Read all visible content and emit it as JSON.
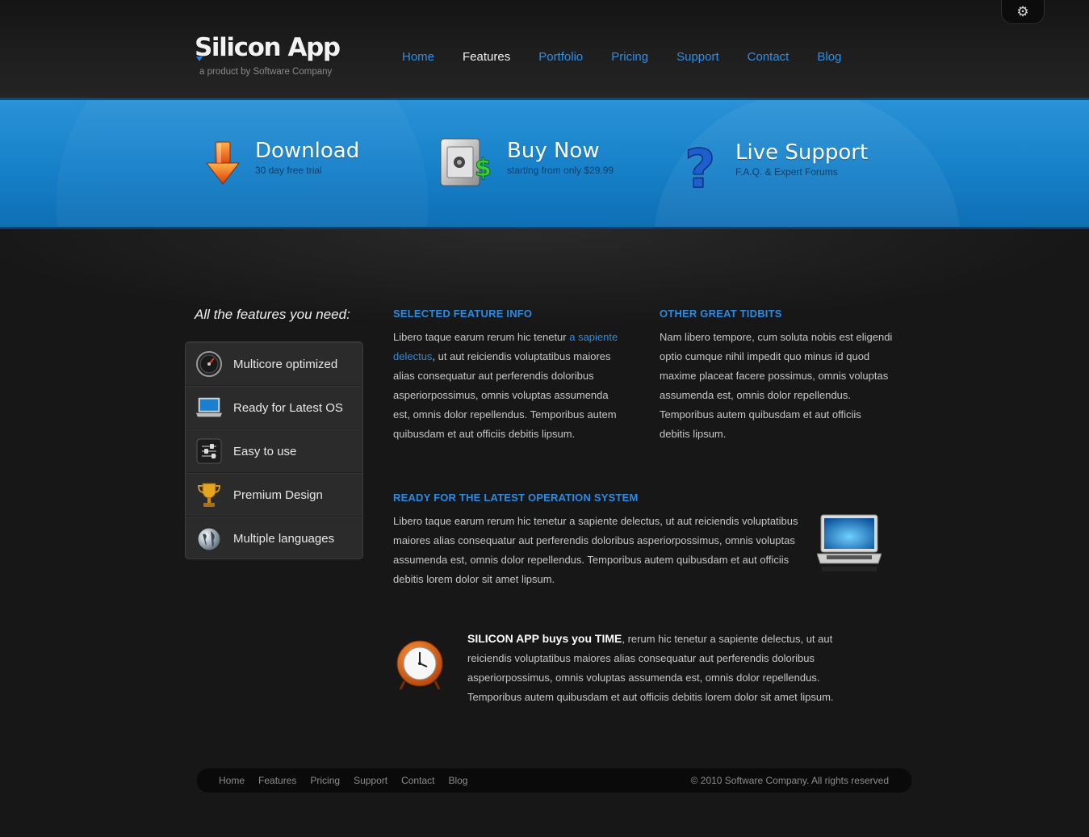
{
  "header": {
    "logo_title": "Silicon App",
    "logo_subtitle": "a product by Software Company",
    "settings_icon": "gears-icon",
    "nav": [
      {
        "label": "Home",
        "active": false
      },
      {
        "label": "Features",
        "active": true
      },
      {
        "label": "Portfolio",
        "active": false
      },
      {
        "label": "Pricing",
        "active": false
      },
      {
        "label": "Support",
        "active": false
      },
      {
        "label": "Contact",
        "active": false
      },
      {
        "label": "Blog",
        "active": false
      }
    ]
  },
  "banner": {
    "download": {
      "title": "Download",
      "subtitle": "30 day free trial",
      "icon": "download-arrow-icon"
    },
    "buy": {
      "title": "Buy Now",
      "subtitle": "starting from only $29.99",
      "icon": "safe-dollar-icon"
    },
    "support": {
      "title": "Live Support",
      "subtitle": "F.A.Q. & Expert Forums",
      "icon": "question-mark-icon"
    }
  },
  "features": {
    "heading": "All the features you need:",
    "items": [
      {
        "label": "Multicore optimized",
        "icon": "speedometer-icon"
      },
      {
        "label": "Ready for Latest OS",
        "icon": "laptop-icon"
      },
      {
        "label": "Easy to use",
        "icon": "sliders-icon"
      },
      {
        "label": "Premium Design",
        "icon": "trophy-icon"
      },
      {
        "label": "Multiple languages",
        "icon": "globe-icon"
      }
    ]
  },
  "selected": {
    "heading": "SELECTED FEATURE INFO",
    "text_before": "Libero taque earum rerum hic tenetur ",
    "link": "a sapiente delectus",
    "text_after": ", ut aut reiciendis voluptatibus maiores alias consequatur aut perferendis doloribus asperiorpossimus, omnis voluptas assumenda est, omnis dolor repellendus. Temporibus autem quibusdam et aut officiis debitis lipsum."
  },
  "tidbits": {
    "heading": "OTHER GREAT TIDBITS",
    "text": "Nam libero tempore, cum soluta nobis est eligendi optio cumque nihil impedit quo minus id quod maxime placeat facere possimus, omnis voluptas assumenda est, omnis dolor repellendus. Temporibus autem quibusdam et aut officiis debitis lipsum."
  },
  "os": {
    "heading": "READY FOR THE LATEST OPERATION SYSTEM",
    "text": "Libero taque earum rerum hic tenetur a sapiente delectus, ut aut reiciendis voluptatibus maiores alias consequatur aut perferendis doloribus asperiorpossimus, omnis voluptas assumenda est, omnis dolor repellendus. Temporibus autem quibusdam et aut officiis debitis lorem dolor sit amet lipsum.",
    "icon": "laptop-icon"
  },
  "time": {
    "bold": "SILICON APP buys you TIME",
    "text": ", rerum hic tenetur a sapiente delectus, ut aut reiciendis voluptatibus maiores alias consequatur aut perferendis doloribus asperiorpossimus, omnis voluptas assumenda est, omnis dolor repellendus. Temporibus autem quibusdam et aut officiis debitis lorem dolor sit amet lipsum.",
    "icon": "alarm-clock-icon"
  },
  "footer": {
    "links": [
      "Home",
      "Features",
      "Pricing",
      "Support",
      "Contact",
      "Blog"
    ],
    "copyright": "© 2010 Software Company. All rights reserved"
  },
  "colors": {
    "accent": "#2e8ae0",
    "banner_blue": "#1680c9",
    "background": "#171717"
  }
}
